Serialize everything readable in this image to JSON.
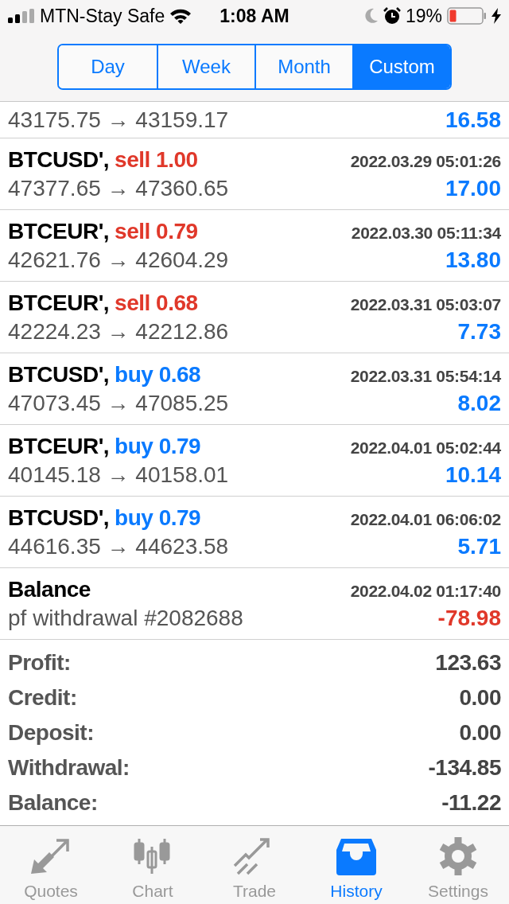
{
  "status_bar": {
    "carrier": "MTN-Stay Safe",
    "time": "1:08 AM",
    "battery": "19%"
  },
  "periods": [
    {
      "label": "Day",
      "selected": false
    },
    {
      "label": "Week",
      "selected": false
    },
    {
      "label": "Month",
      "selected": false
    },
    {
      "label": "Custom",
      "selected": true
    }
  ],
  "deals": [
    {
      "kind": "partial",
      "prices": "43175.75 → 43159.17",
      "profit": "16.58",
      "loss": false
    },
    {
      "kind": "sell",
      "symbol": "BTCUSD',",
      "action": "sell 1.00",
      "time": "2022.03.29 05:01:26",
      "prices": "47377.65 → 47360.65",
      "profit": "17.00",
      "loss": false
    },
    {
      "kind": "sell",
      "symbol": "BTCEUR',",
      "action": "sell 0.79",
      "time": "2022.03.30 05:11:34",
      "prices": "42621.76 → 42604.29",
      "profit": "13.80",
      "loss": false
    },
    {
      "kind": "sell",
      "symbol": "BTCEUR',",
      "action": "sell 0.68",
      "time": "2022.03.31 05:03:07",
      "prices": "42224.23 → 42212.86",
      "profit": "7.73",
      "loss": false
    },
    {
      "kind": "buy",
      "symbol": "BTCUSD',",
      "action": "buy 0.68",
      "time": "2022.03.31 05:54:14",
      "prices": "47073.45 → 47085.25",
      "profit": "8.02",
      "loss": false
    },
    {
      "kind": "buy",
      "symbol": "BTCEUR',",
      "action": "buy 0.79",
      "time": "2022.04.01 05:02:44",
      "prices": "40145.18 → 40158.01",
      "profit": "10.14",
      "loss": false
    },
    {
      "kind": "buy",
      "symbol": "BTCUSD',",
      "action": "buy 0.79",
      "time": "2022.04.01 06:06:02",
      "prices": "44616.35 → 44623.58",
      "profit": "5.71",
      "loss": false
    },
    {
      "kind": "balance",
      "symbol": "Balance",
      "time": "2022.04.02 01:17:40",
      "prices": "pf withdrawal #2082688",
      "profit": "-78.98",
      "loss": true
    }
  ],
  "summary": [
    {
      "label": "Profit:",
      "value": "123.63"
    },
    {
      "label": "Credit:",
      "value": "0.00"
    },
    {
      "label": "Deposit:",
      "value": "0.00"
    },
    {
      "label": "Withdrawal:",
      "value": "-134.85"
    },
    {
      "label": "Balance:",
      "value": "-11.22"
    }
  ],
  "tab_bar": [
    {
      "label": "Quotes",
      "selected": false
    },
    {
      "label": "Chart",
      "selected": false
    },
    {
      "label": "Trade",
      "selected": false
    },
    {
      "label": "History",
      "selected": true
    },
    {
      "label": "Settings",
      "selected": false
    }
  ]
}
